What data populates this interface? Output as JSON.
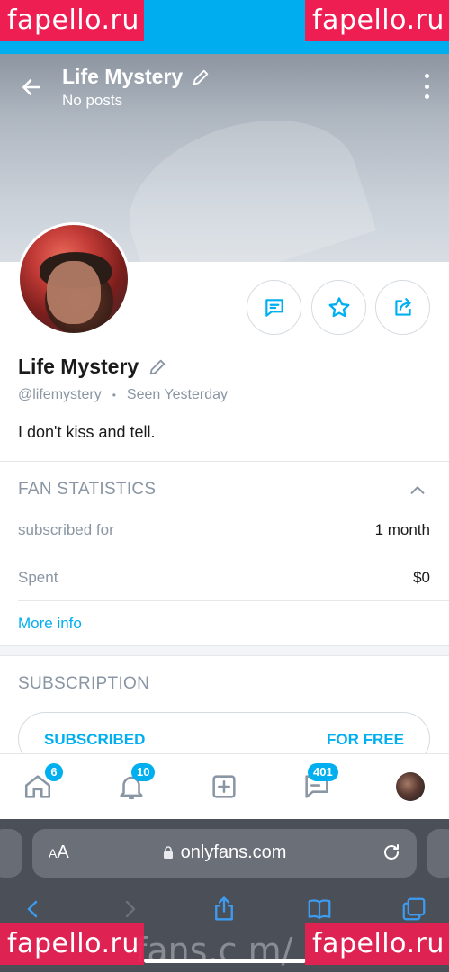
{
  "watermark": {
    "text": "fapello.ru"
  },
  "header": {
    "title": "Life Mystery",
    "subtitle": "No posts"
  },
  "profile": {
    "name": "Life Mystery",
    "handle": "@lifemystery",
    "separator": "•",
    "last_seen": "Seen Yesterday",
    "bio": "I don't kiss and tell."
  },
  "fan_statistics": {
    "title": "FAN STATISTICS",
    "rows": [
      {
        "label": "subscribed for",
        "value": "1 month"
      },
      {
        "label": "Spent",
        "value": "$0"
      }
    ],
    "more_info": "More info"
  },
  "subscription": {
    "title": "SUBSCRIPTION",
    "status": "SUBSCRIBED",
    "price": "FOR FREE"
  },
  "bottom_nav": {
    "home_badge": "6",
    "notifications_badge": "10",
    "messages_badge": "401"
  },
  "browser": {
    "text_size_label_small": "A",
    "text_size_label_large": "A",
    "url": "onlyfans.com",
    "ghost_text": "fans.c m/"
  },
  "colors": {
    "accent": "#00aff0",
    "status_bar": "#00aeef",
    "watermark": "#ee1d52",
    "muted_text": "#8a96a3"
  }
}
